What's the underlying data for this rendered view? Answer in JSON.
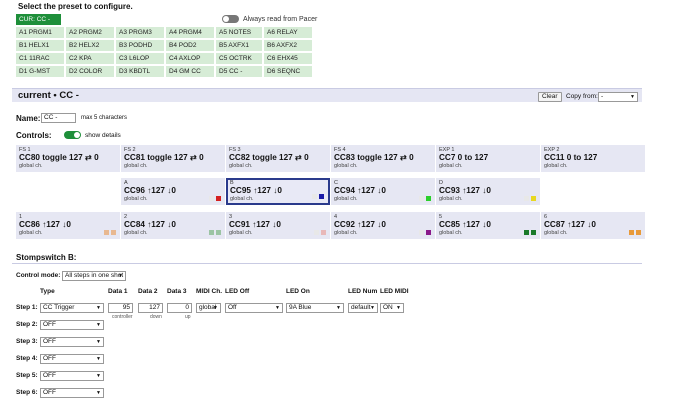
{
  "header": {
    "title": "Select the preset to configure.",
    "always_read_label": "Always read from Pacer"
  },
  "presets": {
    "cur": "CUR: CC -",
    "rows": [
      [
        "A1 PRGM1",
        "A2 PRGM2",
        "A3 PRGM3",
        "A4 PRGM4",
        "A5 NOTES",
        "A6 RELAY"
      ],
      [
        "B1 HELX1",
        "B2 HELX2",
        "B3 PODHD",
        "B4 POD2",
        "B5 AXFX1",
        "B6 AXFX2"
      ],
      [
        "C1 11RAC",
        "C2 KPA",
        "C3 L6LOP",
        "C4 AXLOP",
        "C5 OCTRK",
        "C6 EHX45"
      ],
      [
        "D1 G-MST",
        "D2 COLOR",
        "D3 KBDTL",
        "D4 GM CC",
        "D5 CC -",
        "D6 SEQNC"
      ]
    ]
  },
  "current": {
    "title": "current • CC -",
    "clear_label": "Clear",
    "copy_from_label": "Copy from:",
    "copy_from_value": "-"
  },
  "name": {
    "label": "Name:",
    "value": "CC -",
    "hint": "max 5 characters"
  },
  "controls": {
    "label": "Controls:",
    "show_details_label": "show details",
    "row1": [
      {
        "label": "FS 1",
        "main": "CC80 toggle 127 ⇄ 0",
        "sub": "global ch."
      },
      {
        "label": "FS 2",
        "main": "CC81 toggle 127 ⇄ 0",
        "sub": "global ch."
      },
      {
        "label": "FS 3",
        "main": "CC82 toggle 127 ⇄ 0",
        "sub": "global ch."
      },
      {
        "label": "FS 4",
        "main": "CC83 toggle 127 ⇄ 0",
        "sub": "global ch."
      },
      {
        "label": "EXP 1",
        "main": "CC7 0 to 127",
        "sub": "global ch."
      },
      {
        "label": "EXP 2",
        "main": "CC11 0 to 127",
        "sub": "global ch."
      }
    ],
    "row2": [
      {
        "label": "A",
        "main": "CC96 ↑127 ↓0",
        "sub": "global ch.",
        "c1": "#e8e8e8",
        "c2": "#d42020"
      },
      {
        "label": "B",
        "main": "CC95 ↑127 ↓0",
        "sub": "global ch.",
        "c1": "#e8e8e8",
        "c2": "#1a1aa8"
      },
      {
        "label": "C",
        "main": "CC94 ↑127 ↓0",
        "sub": "global ch.",
        "c1": "#e8e8e8",
        "c2": "#2bcf2b"
      },
      {
        "label": "D",
        "main": "CC93 ↑127 ↓0",
        "sub": "global ch.",
        "c1": "#e8e8e8",
        "c2": "#e8d820"
      }
    ],
    "row3": [
      {
        "label": "1",
        "main": "CC86 ↑127 ↓0",
        "sub": "global ch.",
        "c1": "#e8b890",
        "c2": "#e8b890"
      },
      {
        "label": "2",
        "main": "CC84 ↑127 ↓0",
        "sub": "global ch.",
        "c1": "#9cc4a4",
        "c2": "#9cc4a4"
      },
      {
        "label": "3",
        "main": "CC91 ↑127 ↓0",
        "sub": "global ch.",
        "c1": "#e8e8e8",
        "c2": "#e8b8b8"
      },
      {
        "label": "4",
        "main": "CC92 ↑127 ↓0",
        "sub": "global ch.",
        "c1": "#e8e8e8",
        "c2": "#8a1a8a"
      },
      {
        "label": "5",
        "main": "CC85 ↑127 ↓0",
        "sub": "global ch.",
        "c1": "#1a7a2a",
        "c2": "#1a7a2a"
      },
      {
        "label": "6",
        "main": "CC87 ↑127 ↓0",
        "sub": "global ch.",
        "c1": "#e89a3a",
        "c2": "#e89a3a"
      }
    ]
  },
  "stompswitch": {
    "title": "Stompswitch B:",
    "control_mode_label": "Control mode:",
    "control_mode_value": "All steps in one shot",
    "columns": {
      "type": "Type",
      "data1": "Data 1",
      "data2": "Data 2",
      "data3": "Data 3",
      "midi_ch": "MIDI Ch.",
      "led_off": "LED Off",
      "led_on": "LED On",
      "led_num": "LED Num",
      "led_midi": "LED MIDI"
    },
    "step1": {
      "label": "Step 1:",
      "type": "CC Trigger",
      "data1": "95",
      "data2": "127",
      "data3": "0",
      "data1_hint": "controller",
      "data2_hint": "down",
      "data3_hint": "up",
      "midi_ch": "global",
      "led_off": "Off",
      "led_on": "9A Blue",
      "led_num": "default",
      "led_midi": "ON"
    },
    "steps": [
      {
        "label": "Step 2:",
        "type": "OFF"
      },
      {
        "label": "Step 3:",
        "type": "OFF"
      },
      {
        "label": "Step 4:",
        "type": "OFF"
      },
      {
        "label": "Step 5:",
        "type": "OFF"
      },
      {
        "label": "Step 6:",
        "type": "OFF"
      }
    ]
  }
}
